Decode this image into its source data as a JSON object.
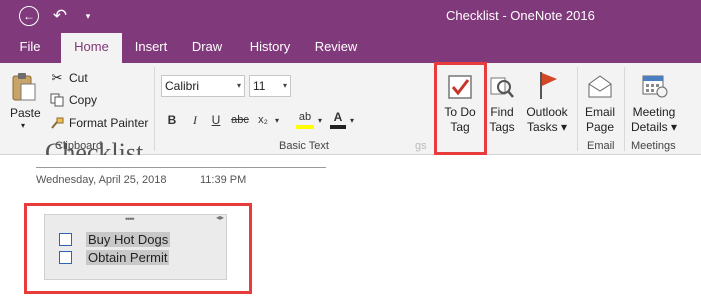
{
  "window": {
    "title": "Checklist  -  OneNote 2016"
  },
  "qat": {
    "back_glyph": "←",
    "undo_glyph": "↶",
    "more_glyph": "▾"
  },
  "tabs": [
    {
      "label": "File"
    },
    {
      "label": "Home"
    },
    {
      "label": "Insert"
    },
    {
      "label": "Draw"
    },
    {
      "label": "History"
    },
    {
      "label": "Review"
    }
  ],
  "clipboard": {
    "paste": "Paste",
    "cut": "Cut",
    "copy": "Copy",
    "format_painter": "Format Painter",
    "group_label": "Clipboard"
  },
  "basic_text": {
    "font": "Calibri",
    "size": "11",
    "bold": "B",
    "italic": "I",
    "underline": "U",
    "strike": "abc",
    "subscript": "x₂",
    "highlight": "ab",
    "font_color": "A",
    "group_label": "Basic Text"
  },
  "tags": {
    "todo_line1": "To Do",
    "todo_line2": "Tag",
    "find_line1": "Find",
    "find_line2": "Tags",
    "outlook_line1": "Outlook",
    "outlook_line2": "Tasks ▾",
    "group_label_fragment": "gs"
  },
  "email": {
    "line1": "Email",
    "line2": "Page",
    "group_label": "Email"
  },
  "meetings": {
    "line1": "Meeting",
    "line2": "Details ▾",
    "group_label": "Meetings"
  },
  "page": {
    "title": "Checklist",
    "date": "Wednesday, April 25, 2018",
    "time": "11:39 PM"
  },
  "checklist": [
    {
      "text": "Buy Hot Dogs",
      "checked": false
    },
    {
      "text": "Obtain Permit",
      "checked": false
    }
  ],
  "colors": {
    "brand": "#80397b",
    "highlight_box": "#e83c3c",
    "checkbox": "#2f64b4",
    "check_mark": "#c4372c",
    "flag": "#d24726"
  }
}
